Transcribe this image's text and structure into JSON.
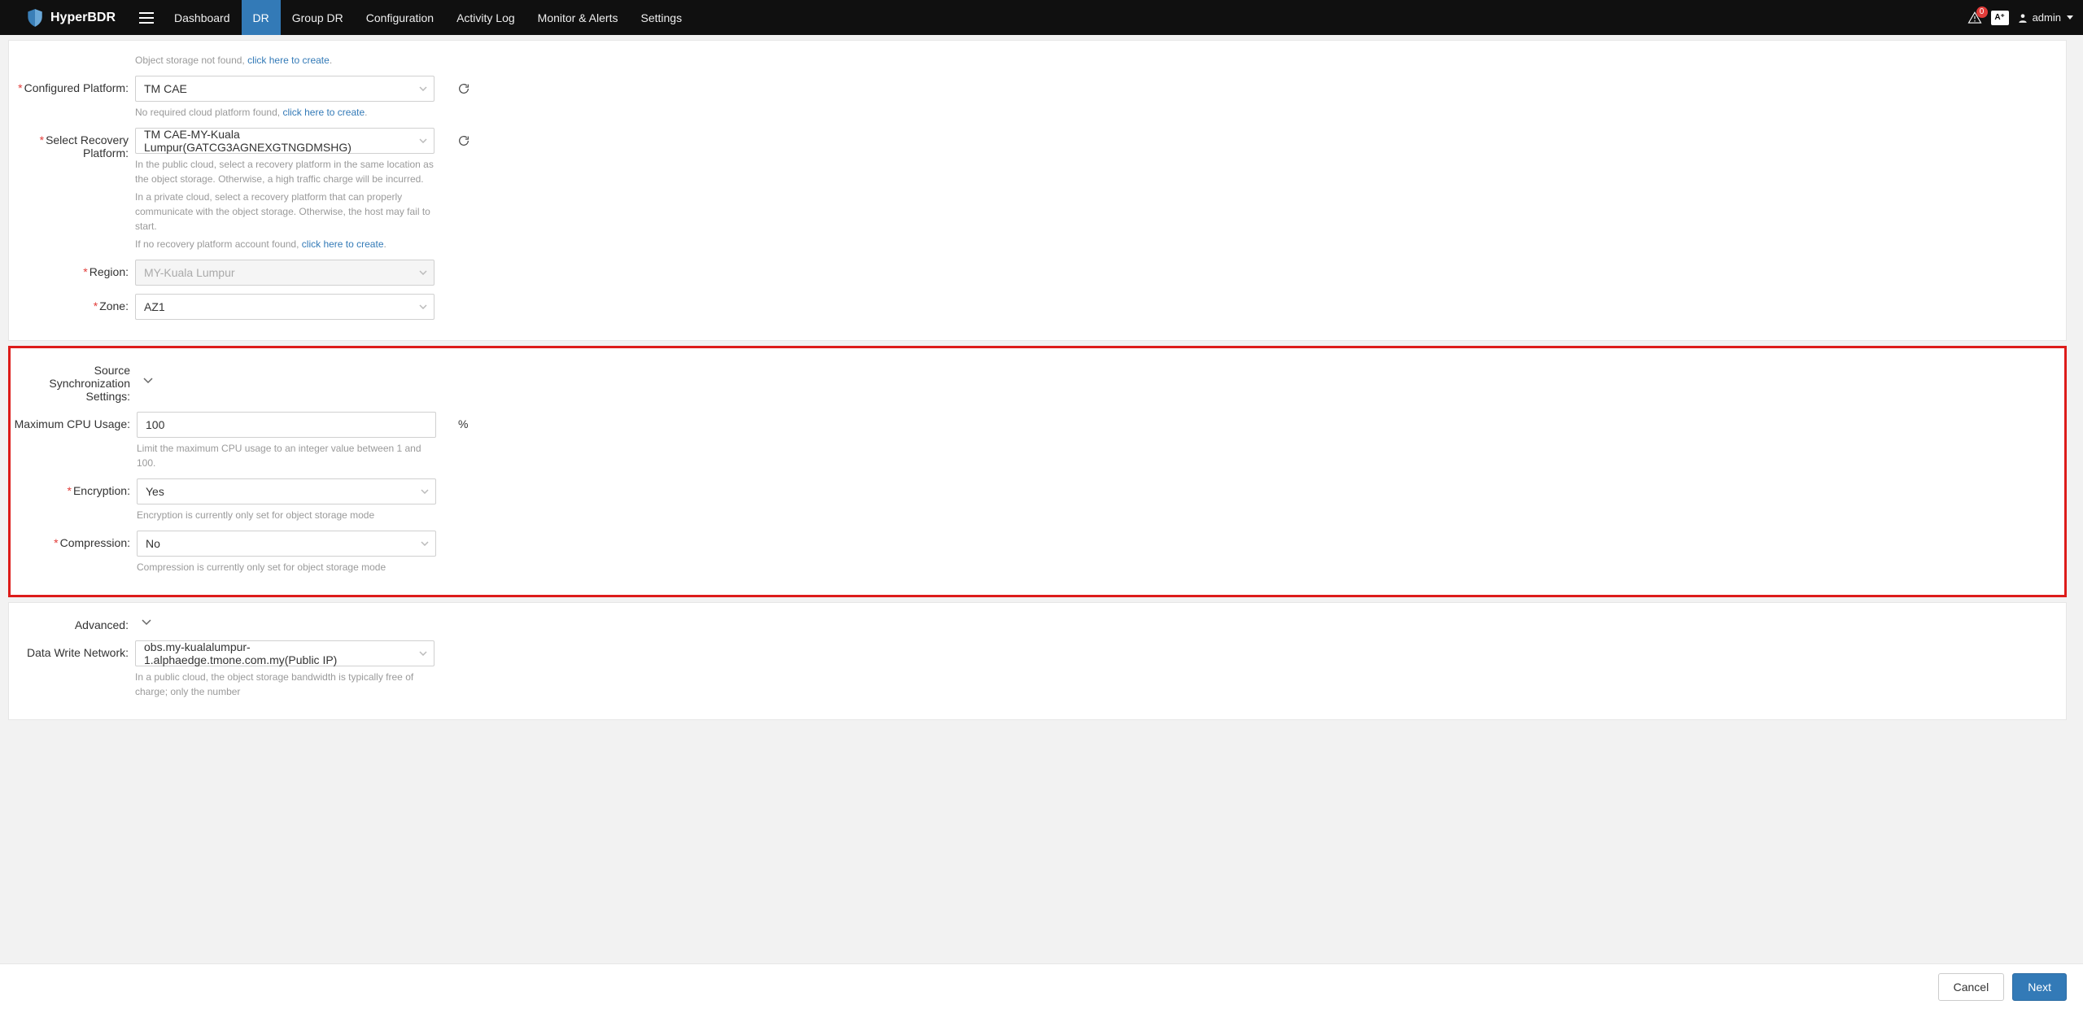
{
  "brand": "HyperBDR",
  "nav": {
    "items": [
      {
        "id": "dashboard",
        "label": "Dashboard"
      },
      {
        "id": "dr",
        "label": "DR",
        "active": true
      },
      {
        "id": "group-dr",
        "label": "Group DR"
      },
      {
        "id": "configuration",
        "label": "Configuration"
      },
      {
        "id": "activity-log",
        "label": "Activity Log"
      },
      {
        "id": "monitor-alerts",
        "label": "Monitor & Alerts"
      },
      {
        "id": "settings",
        "label": "Settings"
      }
    ]
  },
  "topRight": {
    "alertCount": "0",
    "langBadge": "A⁺",
    "userName": "admin"
  },
  "form": {
    "objectStorageHint": "Object storage not found, ",
    "objectStorageLink": "click here to create",
    "objectStorageDot": ".",
    "configuredPlatformLabel": "Configured Platform:",
    "configuredPlatformValue": "TM CAE",
    "configuredPlatformHint": "No required cloud platform found, ",
    "configuredPlatformLink": "click here to create",
    "configuredPlatformDot": ".",
    "selectRecoveryPlatformLabel": "Select Recovery Platform:",
    "selectRecoveryPlatformValue": "TM CAE-MY-Kuala Lumpur(GATCG3AGNEXGTNGDMSHG)",
    "recoveryHint1": "In the public cloud, select a recovery platform in the same location as the object storage. Otherwise, a high traffic charge will be incurred.",
    "recoveryHint2": "In a private cloud, select a recovery platform that can properly communicate with the object storage. Otherwise, the host may fail to start.",
    "recoveryHint3a": "If no recovery platform account found, ",
    "recoveryHint3Link": "click here to create",
    "recoveryHint3Dot": ".",
    "regionLabel": "Region:",
    "regionValue": "MY-Kuala Lumpur",
    "zoneLabel": "Zone:",
    "zoneValue": "AZ1",
    "syncSection": "Source Synchronization Settings:",
    "maxCpuLabel": "Maximum CPU Usage:",
    "maxCpuValue": "100",
    "maxCpuUnit": "%",
    "maxCpuHint": "Limit the maximum CPU usage to an integer value between 1 and 100.",
    "encryptionLabel": "Encryption:",
    "encryptionValue": "Yes",
    "encryptionHint": "Encryption is currently only set for object storage mode",
    "compressionLabel": "Compression:",
    "compressionValue": "No",
    "compressionHint": "Compression is currently only set for object storage mode",
    "advancedSection": "Advanced:",
    "dataWriteLabel": "Data Write Network:",
    "dataWriteValue": "obs.my-kualalumpur-1.alphaedge.tmone.com.my(Public IP)",
    "dataWriteHint": "In a public cloud, the object storage bandwidth is typically free of charge; only the number"
  },
  "footer": {
    "cancel": "Cancel",
    "next": "Next"
  },
  "colors": {
    "accent": "#337ab7",
    "danger": "#e23c39",
    "highlight": "#dd1c1a"
  }
}
